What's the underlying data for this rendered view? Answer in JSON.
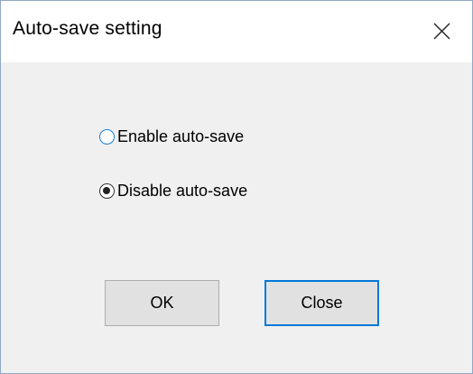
{
  "dialog": {
    "title": "Auto-save setting",
    "close_icon": "close-x-icon"
  },
  "options": [
    {
      "label": "Enable auto-save",
      "selected": false
    },
    {
      "label": "Disable auto-save",
      "selected": true
    }
  ],
  "buttons": {
    "ok_label": "OK",
    "close_label": "Close"
  },
  "colors": {
    "focus_accent": "#0078d7",
    "button_face": "#e1e1e1",
    "dialog_background": "#f0f0f0"
  }
}
